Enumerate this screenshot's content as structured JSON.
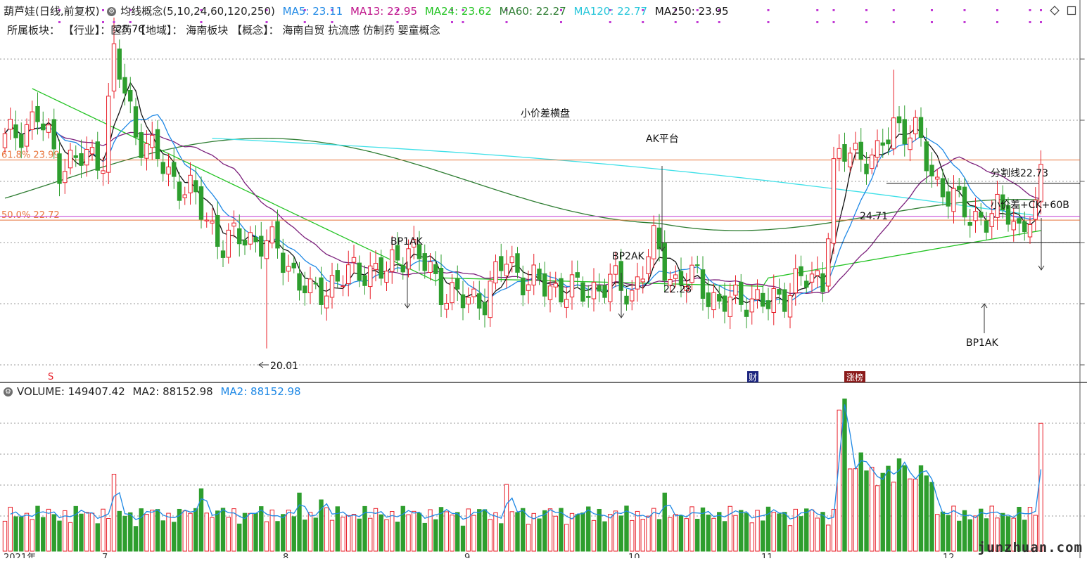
{
  "header": {
    "stock_name": "葫芦娃(日线,前复权)",
    "ma_concept": "均线概念(5,10,24,60,120,250)",
    "ma_values": [
      {
        "label": "MA5: 23.11",
        "color": "#1e88e5"
      },
      {
        "label": "MA13: 22.95",
        "color": "#c0168b"
      },
      {
        "label": "MA24: 23.62",
        "color": "#22c322"
      },
      {
        "label": "MA60: 22.27",
        "color": "#2e7d32"
      },
      {
        "label": "MA120: 22.77",
        "color": "#26c6da"
      },
      {
        "label": "MA250: 23.95",
        "color": "#111111"
      }
    ],
    "sector_line": "所属板块：  【行业】：医药  【地域】：  海南板块   【概念】：  海南自贸 抗流感 仿制药 婴童概念"
  },
  "volume_header": {
    "label": "VOLUME: 149407.42",
    "ma2_a": "MA2: 88152.98",
    "ma2_b": "MA2: 88152.98"
  },
  "colors": {
    "up": "#e8202a",
    "down": "#2e9e2e",
    "ma_fast": "#111111",
    "ma_blue": "#1e88e5",
    "ma_purple": "#7b1f7b",
    "ma_green": "#22c322",
    "ma_dark": "#2e7d32",
    "ma_cyan": "#40e0e8",
    "fib": "#e8743b",
    "magenta": "#c23bd4",
    "grid": "#9a9a9a"
  },
  "icons": [
    "info-circle-icon",
    "diamond-icon",
    "maximize-icon"
  ],
  "watermark": "junzhuan.com",
  "chart_data": {
    "type": "candlestick",
    "price_scale": [
      19.5,
      27.0
    ],
    "volume_scale": [
      0,
      180000
    ],
    "x_labels": [
      "2021年",
      "7",
      "8",
      "9",
      "10",
      "11",
      "12"
    ],
    "horizontal_lines": [
      {
        "label": "61.8% 23.99",
        "value": 23.99,
        "color": "#e8743b"
      },
      {
        "label": "50.0% 22.72",
        "value": 22.72,
        "color": "#e8743b"
      },
      {
        "label": "",
        "value": 22.8,
        "color": "#c23bd4"
      },
      {
        "label": "",
        "value": 22.25,
        "color": "#111111"
      },
      {
        "label": "",
        "value": 23.5,
        "color": "#111111"
      }
    ],
    "annotations": [
      {
        "text": "小价差横盘"
      },
      {
        "text": "AK平台"
      },
      {
        "text": "BP1AK"
      },
      {
        "text": "BP2AK"
      },
      {
        "text": "22.28"
      },
      {
        "text": "24.71"
      },
      {
        "text": "分割线22.73"
      },
      {
        "text": "小价差+CK+60B"
      },
      {
        "text": "BP1AK"
      },
      {
        "text": "20.01"
      },
      {
        "text": "25.76"
      }
    ],
    "markers": [
      {
        "text": "S",
        "color": "#e8202a"
      },
      {
        "text": "财",
        "color": "#1a237e"
      },
      {
        "text": "涨榜",
        "color": "#8b1a1a"
      }
    ],
    "anchors": [
      {
        "i": 0,
        "c": 24.4
      },
      {
        "i": 6,
        "c": 24.9
      },
      {
        "i": 10,
        "c": 23.9
      },
      {
        "i": 14,
        "c": 24.0
      },
      {
        "i": 18,
        "c": 24.1
      },
      {
        "i": 20,
        "c": 26.2
      },
      {
        "i": 24,
        "c": 24.6
      },
      {
        "i": 30,
        "c": 23.7
      },
      {
        "i": 34,
        "c": 23.3
      },
      {
        "i": 40,
        "c": 22.2
      },
      {
        "i": 44,
        "c": 22.4
      },
      {
        "i": 50,
        "c": 22.1
      },
      {
        "i": 53,
        "c": 21.6
      },
      {
        "i": 56,
        "c": 21.1
      },
      {
        "i": 60,
        "c": 21.4
      },
      {
        "i": 66,
        "c": 21.7
      },
      {
        "i": 70,
        "c": 21.6
      },
      {
        "i": 74,
        "c": 22.2
      },
      {
        "i": 80,
        "c": 21.3
      },
      {
        "i": 84,
        "c": 21.0
      },
      {
        "i": 88,
        "c": 21.1
      },
      {
        "i": 92,
        "c": 21.9
      },
      {
        "i": 96,
        "c": 21.4
      },
      {
        "i": 100,
        "c": 21.3
      },
      {
        "i": 106,
        "c": 21.2
      },
      {
        "i": 111,
        "c": 21.4
      },
      {
        "i": 115,
        "c": 21.2
      },
      {
        "i": 119,
        "c": 22.2
      },
      {
        "i": 123,
        "c": 21.4
      },
      {
        "i": 127,
        "c": 21.5
      },
      {
        "i": 131,
        "c": 20.9
      },
      {
        "i": 136,
        "c": 21.1
      },
      {
        "i": 140,
        "c": 20.9
      },
      {
        "i": 145,
        "c": 21.4
      },
      {
        "i": 150,
        "c": 21.5
      },
      {
        "i": 152,
        "c": 23.8
      },
      {
        "i": 155,
        "c": 24.2
      },
      {
        "i": 160,
        "c": 24.0
      },
      {
        "i": 163,
        "c": 24.8
      },
      {
        "i": 167,
        "c": 24.5
      },
      {
        "i": 171,
        "c": 23.5
      },
      {
        "i": 175,
        "c": 23.0
      },
      {
        "i": 180,
        "c": 22.7
      },
      {
        "i": 184,
        "c": 23.0
      },
      {
        "i": 186,
        "c": 22.5
      },
      {
        "i": 189,
        "c": 22.8
      },
      {
        "i": 190,
        "c": 23.9
      }
    ],
    "volume_spikes": [
      {
        "i": 20,
        "v": 90000
      },
      {
        "i": 36,
        "v": 73000
      },
      {
        "i": 54,
        "v": 68000
      },
      {
        "i": 58,
        "v": 60000
      },
      {
        "i": 92,
        "v": 78000
      },
      {
        "i": 121,
        "v": 68000
      },
      {
        "i": 153,
        "v": 165000
      },
      {
        "i": 154,
        "v": 178000
      },
      {
        "i": 157,
        "v": 115000
      },
      {
        "i": 164,
        "v": 108000
      },
      {
        "i": 190,
        "v": 149407
      }
    ]
  }
}
